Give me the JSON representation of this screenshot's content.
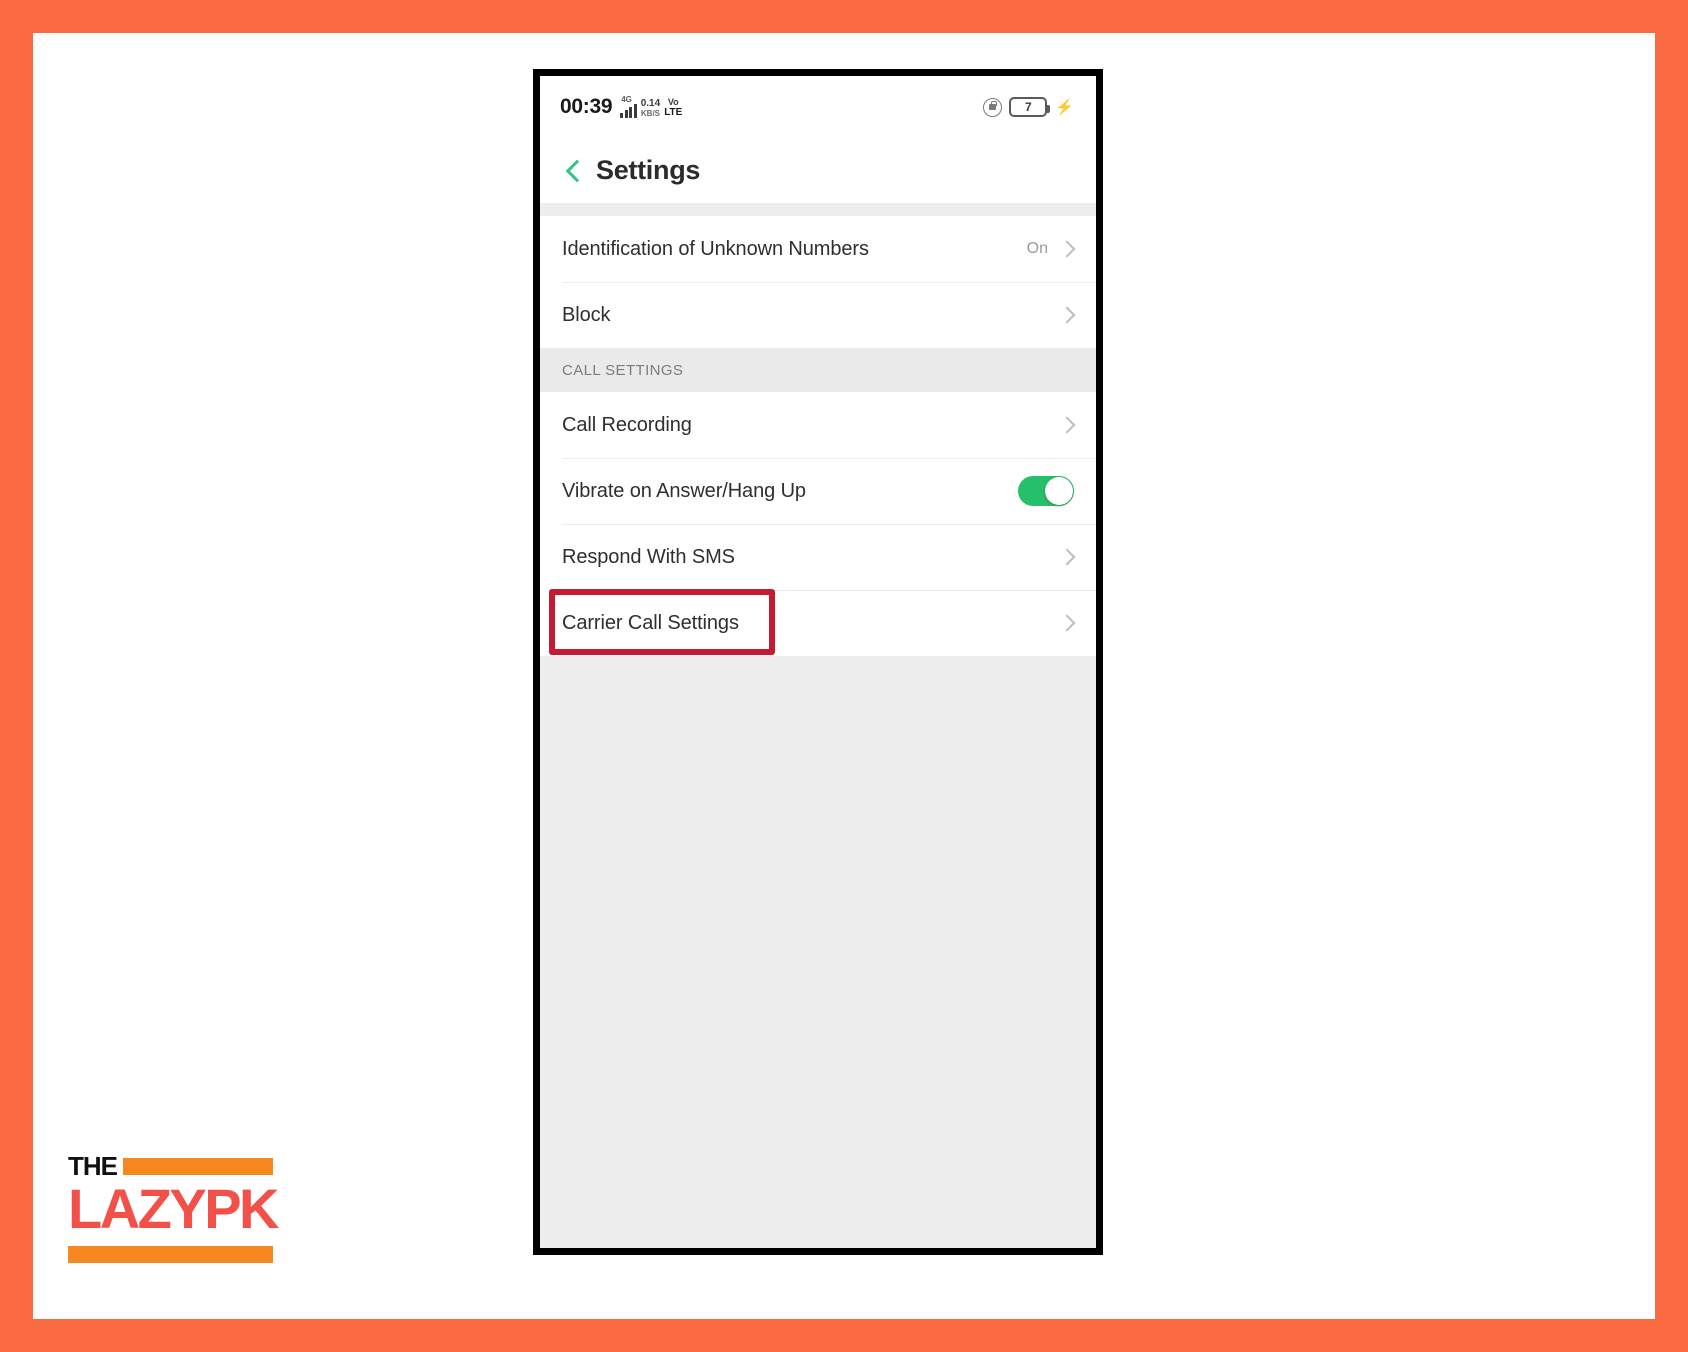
{
  "theme": {
    "border_orange": "#FA6B43",
    "accent_green": "#35C485",
    "toggle_green": "#27C06A",
    "highlight_red": "#C41A33",
    "logo_orange": "#F5881F",
    "logo_red": "#F2514A",
    "section_bg": "#EAEAEA",
    "page_bg": "#EDEDED"
  },
  "status_bar": {
    "time": "00:39",
    "network_type": "4G",
    "signal_icon": "signal-bars-icon",
    "data_rate_value": "0.14",
    "data_rate_unit": "KB/S",
    "volte_line1": "Vo",
    "volte_line2": "LTE",
    "rotation_lock_icon": "rotation-lock-icon",
    "battery_level": "7",
    "battery_icon": "battery-icon",
    "charging_icon": "charging-bolt-icon"
  },
  "title_bar": {
    "back_icon": "back-chevron-icon",
    "title": "Settings"
  },
  "groups": [
    {
      "type": "list",
      "rows": [
        {
          "label": "Identification of Unknown Numbers",
          "value": "On",
          "control": "chevron",
          "name": "row-identification-of-unknown-numbers"
        },
        {
          "label": "Block",
          "value": "",
          "control": "chevron",
          "name": "row-block"
        }
      ]
    },
    {
      "type": "section",
      "header": "CALL SETTINGS",
      "rows": [
        {
          "label": "Call Recording",
          "value": "",
          "control": "chevron",
          "name": "row-call-recording"
        },
        {
          "label": "Vibrate on Answer/Hang Up",
          "value": "",
          "control": "toggle",
          "toggle_on": true,
          "name": "row-vibrate-on-answer-hang-up"
        },
        {
          "label": "Respond With SMS",
          "value": "",
          "control": "chevron",
          "name": "row-respond-with-sms"
        },
        {
          "label": "Carrier Call Settings",
          "value": "",
          "control": "chevron",
          "highlighted": true,
          "name": "row-carrier-call-settings"
        }
      ]
    }
  ],
  "logo": {
    "the": "THE",
    "main": "LAZYPK"
  }
}
